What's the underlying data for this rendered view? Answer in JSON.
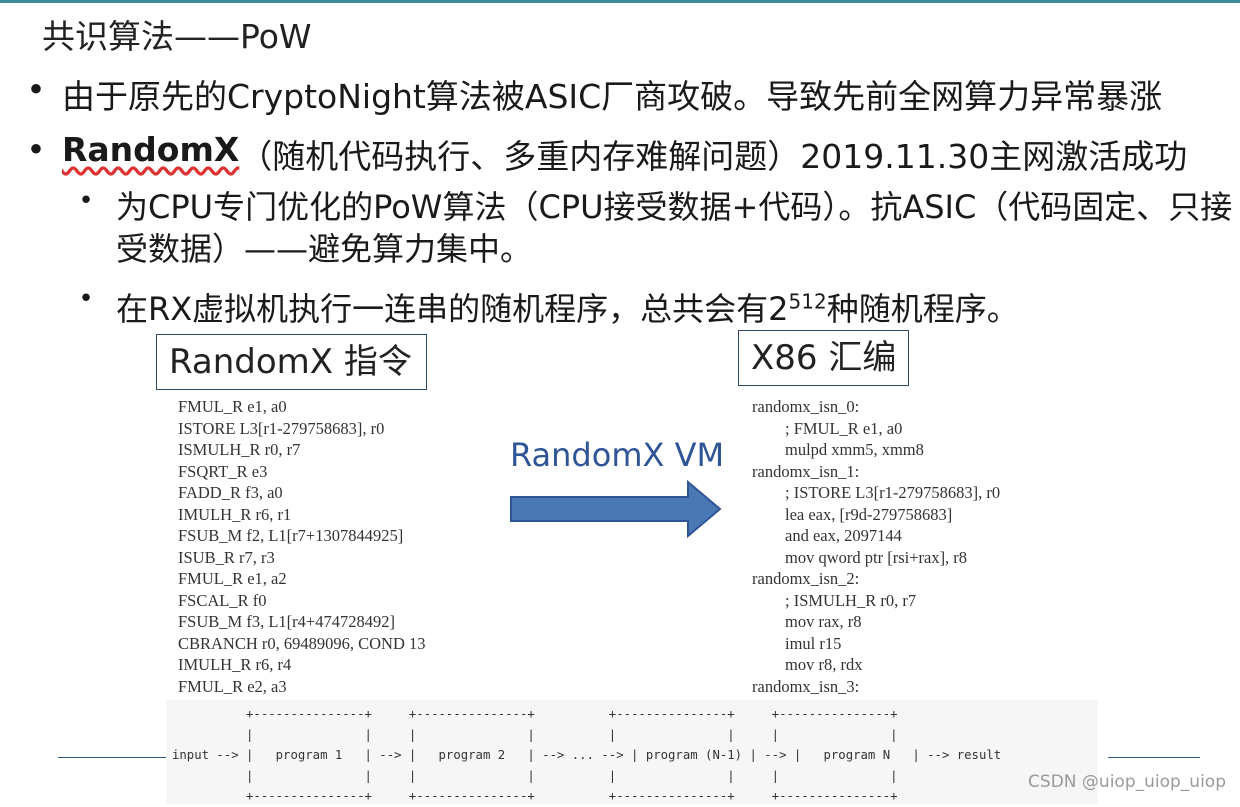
{
  "title": "共识算法——PoW",
  "bullets": {
    "b1": "由于原先的CryptoNight算法被ASIC厂商攻破。导致先前全网算力异常暴涨",
    "b2_strong": "RandomX",
    "b2_rest": "（随机代码执行、多重内存难解问题）2019.11.30主网激活成功",
    "s1": "为CPU专门优化的PoW算法（CPU接受数据+代码）。抗ASIC（代码固定、只接受数据）——避免算力集中。",
    "s2_a": "在RX虚拟机执行一连串的随机程序，总共会有2",
    "s2_sup": "512",
    "s2_b": "种随机程序。",
    "dot": "•"
  },
  "labels": {
    "randomx_instr": "RandomX 指令",
    "x86": "X86 汇编",
    "vm": "RandomX VM"
  },
  "code": {
    "randomx": "FMUL_R e1, a0\nISTORE L3[r1-279758683], r0\nISMULH_R r0, r7\nFSQRT_R e3\nFADD_R f3, a0\nIMULH_R r6, r1\nFSUB_M f2, L1[r7+1307844925]\nISUB_R r7, r3\nFMUL_R e1, a2\nFSCAL_R f0\nFSUB_M f3, L1[r4+474728492]\nCBRANCH r0, 69489096, COND 13\nIMULH_R r6, r4\nFMUL_R e2, a3",
    "x86": "randomx_isn_0:\n        ; FMUL_R e1, a0\n        mulpd xmm5, xmm8\nrandomx_isn_1:\n        ; ISTORE L3[r1-279758683], r0\n        lea eax, [r9d-279758683]\n        and eax, 2097144\n        mov qword ptr [rsi+rax], r8\nrandomx_isn_2:\n        ; ISMULH_R r0, r7\n        mov rax, r8\n        imul r15\n        mov r8, rdx\nrandomx_isn_3:"
  },
  "flow": "          +---------------+     +---------------+          +---------------+     +---------------+\n          |               |     |               |          |               |     |               |\ninput --> |   program 1   | --> |   program 2   | --> ... --> | program (N-1) | --> |   program N   | --> result\n          |               |     |               |          |               |     |               |\n          +---------------+     +---------------+          +---------------+     +---------------+",
  "watermark": "CSDN @uiop_uiop_uiop",
  "colors": {
    "accent_rule": "#3e8c99",
    "arrow_fill": "#4a78b5",
    "arrow_stroke": "#2f5597",
    "vm_text": "#2f5597"
  }
}
